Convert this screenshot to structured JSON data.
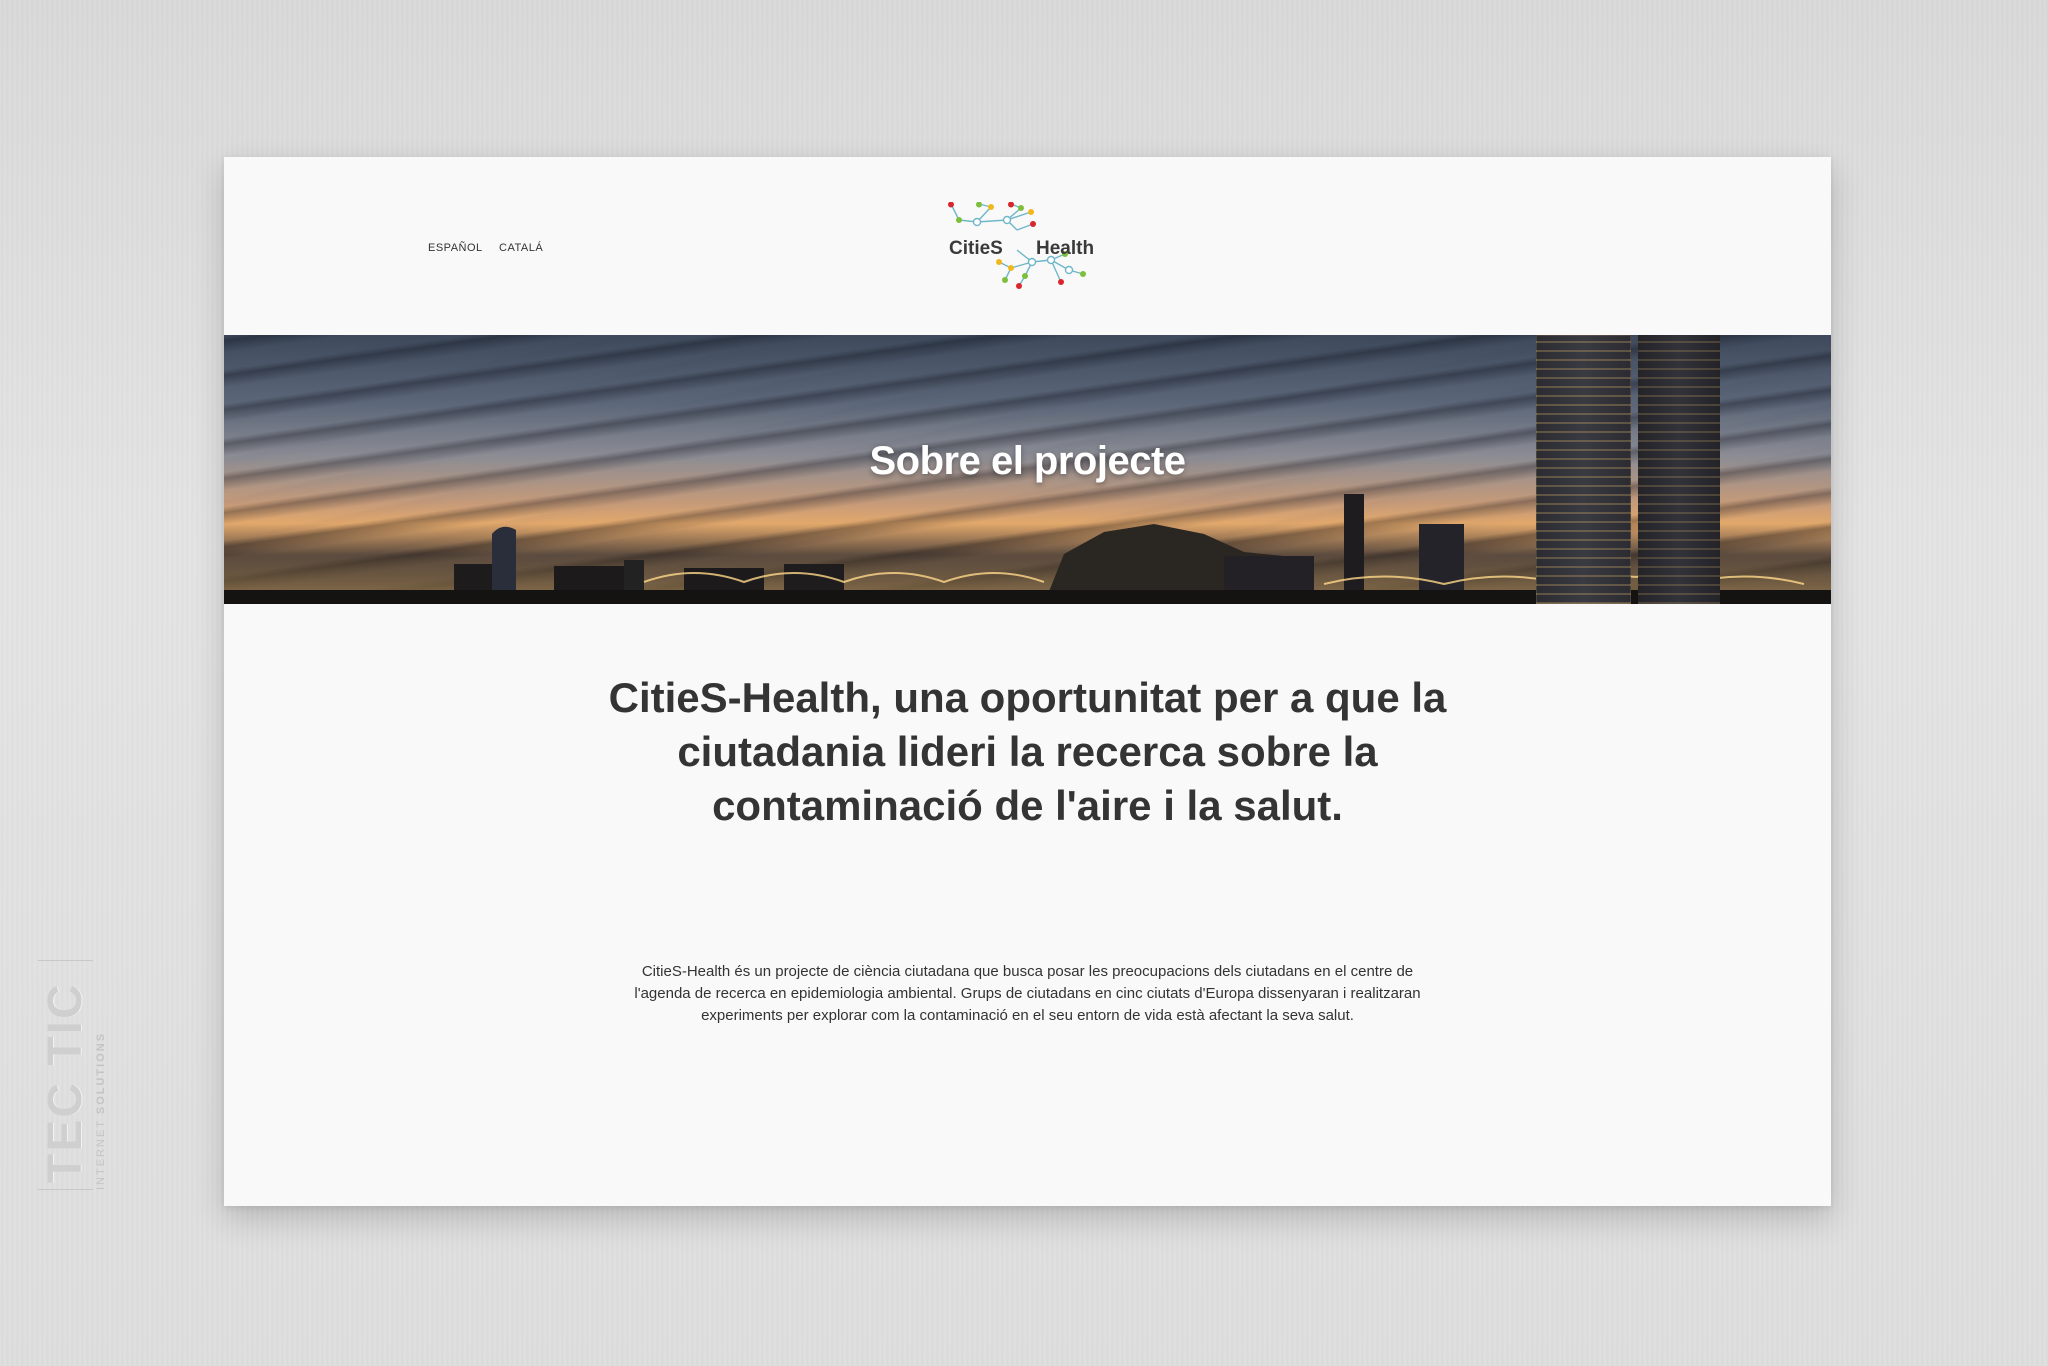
{
  "header": {
    "lang_es": "ESPAÑOL",
    "lang_ca": "CATALÁ",
    "logo_left": "CitieS",
    "logo_right": "Health"
  },
  "hero": {
    "title": "Sobre el projecte"
  },
  "main": {
    "headline": "CitieS-Health, una oportunitat per a que la ciutadania lideri la recerca sobre la contaminació de l'aire i la salut.",
    "body": "CitieS-Health és un projecte de ciència ciutadana que busca posar les preocupacions dels ciutadans en el centre de l'agenda de recerca en epidemiologia ambiental. Grups de ciutadans en cinc ciutats d'Europa dissenyaran i realitzaran experiments per explorar com la contaminació en el seu entorn de vida està afectant la seva salut."
  },
  "watermark": {
    "brand": "TEC TIC",
    "tagline_a": "INTERNET",
    "tagline_b": "SOLUTIONS"
  },
  "colors": {
    "logo_line": "#6fb7c8",
    "node_red": "#d9262c",
    "node_green": "#7cbf3c",
    "node_yellow": "#f2b81b",
    "text_dark": "#343434"
  }
}
